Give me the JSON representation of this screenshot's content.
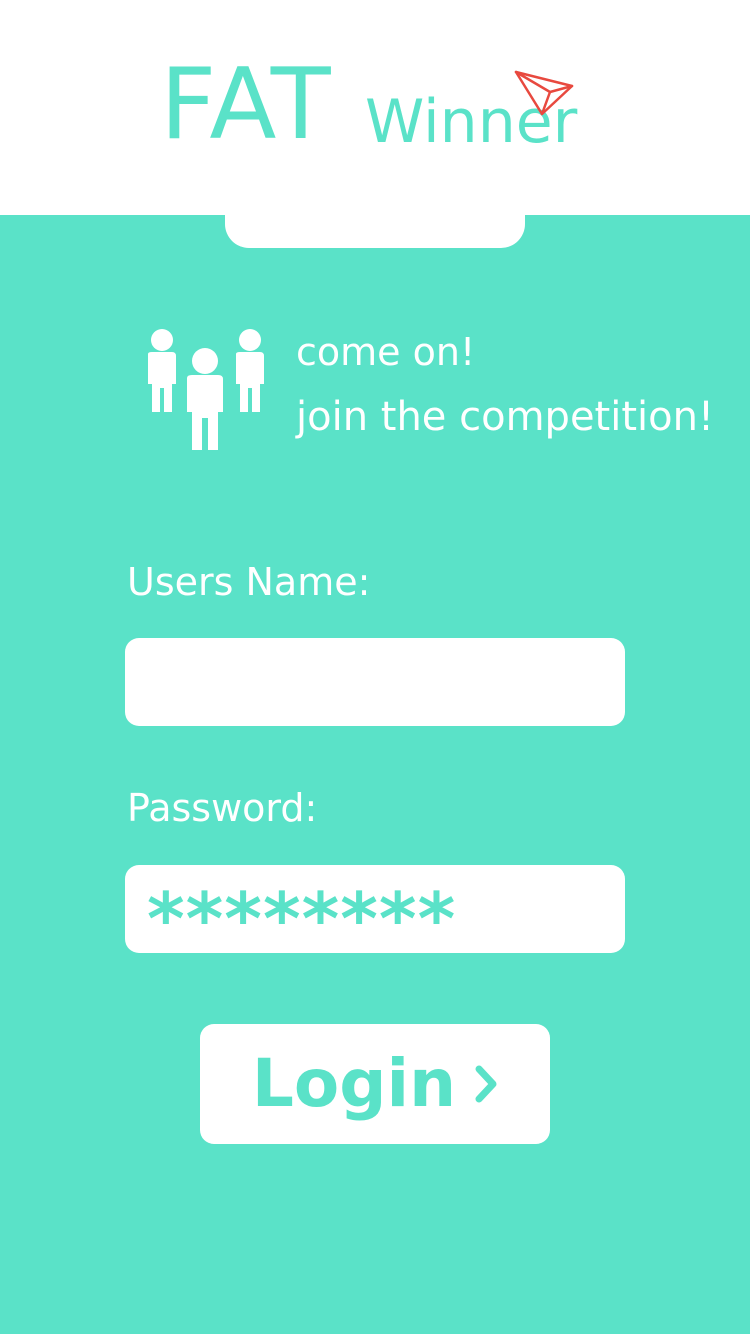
{
  "app": {
    "logo_primary": "FAT",
    "logo_secondary": "Winner"
  },
  "intro": {
    "line1": "come on!",
    "line2": "join the competition!",
    "icon": "people-group-icon"
  },
  "form": {
    "username_label": "Users Name:",
    "username_value": "",
    "password_label": "Password:",
    "password_value": "********",
    "login_label": "Login"
  },
  "colors": {
    "accent": "#5ae2c8",
    "background": "#ffffff",
    "plane": "#e8493f"
  },
  "icons": {
    "logo_decoration": "paper-plane-icon",
    "login_arrow": "chevron-right-icon"
  }
}
